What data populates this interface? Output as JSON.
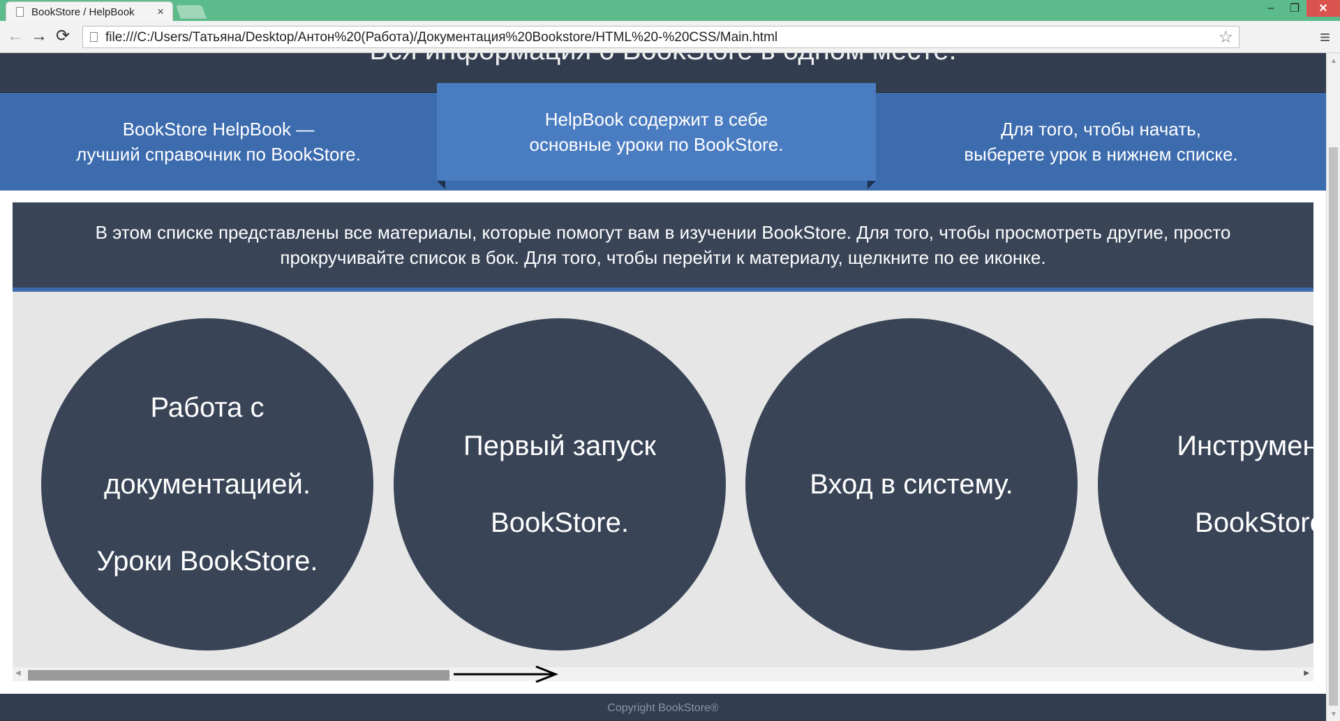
{
  "browser": {
    "tab_title": "BookStore / HelpBook",
    "tab_close": "×",
    "url": "file:///C:/Users/Татьяна/Desktop/Антон%20(Работа)/Документация%20Bookstore/HTML%20-%20CSS/Main.html",
    "win_min": "–",
    "win_max": "❐",
    "win_close": "✕",
    "back": "←",
    "forward": "→",
    "reload": "⟳",
    "star": "☆",
    "menu": "≡"
  },
  "hero": {
    "title": "Вся информация о BookStore в одном месте."
  },
  "features": [
    {
      "line1": "BookStore HelpBook —",
      "line2": "лучший справочник по BookStore."
    },
    {
      "line1": "HelpBook содержит в себе",
      "line2": "основные уроки по BookStore."
    },
    {
      "line1": "Для того, чтобы начать,",
      "line2": "выберете урок в нижнем списке."
    }
  ],
  "notice": {
    "line1": "В этом списке представлены все материалы, которые помогут вам в изучении BookStore. Для того, чтобы просмотреть другие, просто",
    "line2": "прокручивайте список в бок. Для того, чтобы перейти к материалу, щелкните по ее иконке."
  },
  "lessons": [
    {
      "l1": "Работа с",
      "l2": "документацией.",
      "l3": "Уроки BookStore."
    },
    {
      "l1": "Первый запуск",
      "l2": "BookStore."
    },
    {
      "l1": "Вход в систему."
    },
    {
      "l1": "Инструменты",
      "l2": "BookStore."
    }
  ],
  "scroll": {
    "left": "◀",
    "right": "▶",
    "up": "▲",
    "down": "▼"
  },
  "footer": {
    "copyright": "Copyright BookStore®"
  },
  "colors": {
    "dark": "#394457",
    "blue": "#3c6bae",
    "blue_light": "#4a7cc1",
    "chrome_green": "#5bbb8a"
  }
}
